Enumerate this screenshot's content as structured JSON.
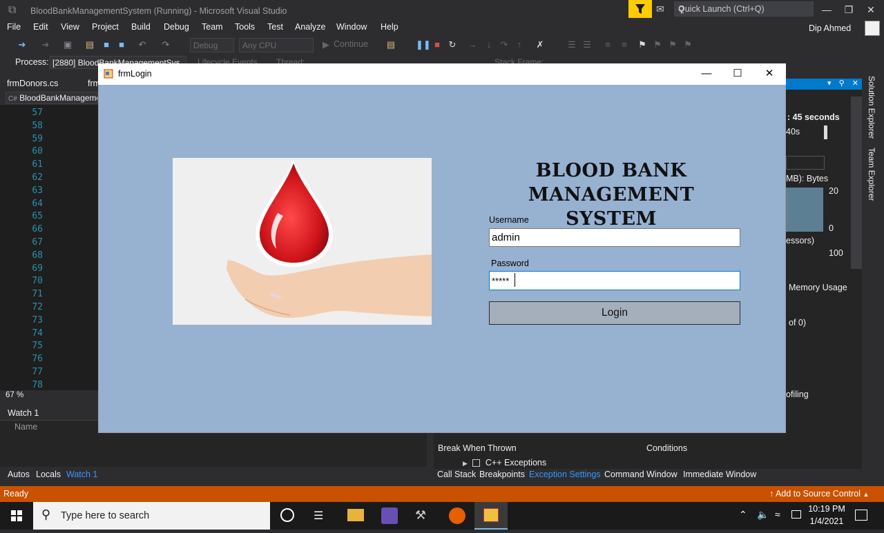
{
  "window": {
    "title": "BloodBankManagementSystem (Running) - Microsoft Visual Studio"
  },
  "quick_launch": {
    "placeholder": "Quick Launch (Ctrl+Q)"
  },
  "menu": [
    "File",
    "Edit",
    "View",
    "Project",
    "Build",
    "Debug",
    "Team",
    "Tools",
    "Test",
    "Analyze",
    "Window",
    "Help"
  ],
  "user": {
    "name": "Dip Ahmed"
  },
  "toolbar": {
    "config": "Debug",
    "platform": "Any CPU",
    "continue": "Continue",
    "process_label": "Process:",
    "process_value": "[2880] BloodBankManagementSys",
    "lifecycle": "Lifecycle Events",
    "thread": "Thread:",
    "stack_frame": "Stack Frame:"
  },
  "doc_tabs": [
    "frmDonors.cs",
    "frm"
  ],
  "nav_bar": "BloodBankManageme",
  "editor": {
    "line_numbers": [
      "57",
      "58",
      "59",
      "60",
      "61",
      "62",
      "63",
      "64",
      "65",
      "66",
      "67",
      "68",
      "69",
      "70",
      "71",
      "72",
      "73",
      "74",
      "75",
      "76",
      "77",
      "78"
    ],
    "zoom": "67 %"
  },
  "watch": {
    "title": "Watch 1",
    "name_col": "Name",
    "tabs": [
      "Autos",
      "Locals",
      "Watch 1"
    ]
  },
  "diagnostics": {
    "time": ": 45 seconds",
    "axis": "40s",
    "mem_label": "MB): Bytes",
    "mem_max": "20",
    "mem_min": "0",
    "cpu_label": "essors)",
    "cpu_max": "100",
    "tab": "Memory Usage",
    "count": "of 0)",
    "profiling": "ofiling"
  },
  "side_tabs": [
    "Solution Explorer",
    "Team Explorer"
  ],
  "exceptions": {
    "col1": "Break When Thrown",
    "col2": "Conditions",
    "row": "C++ Exceptions"
  },
  "debug_tabs": [
    "Call Stack",
    "Breakpoints",
    "Exception Settings",
    "Command Window",
    "Immediate Window"
  ],
  "status": {
    "ready": "Ready",
    "source_control": "Add to Source Control"
  },
  "taskbar": {
    "search_placeholder": "Type here to search",
    "time": "10:19 PM",
    "date": "1/4/2021"
  },
  "form": {
    "title": "frmLogin",
    "app_title_line1": "BLOOD BANK",
    "app_title_line2": "MANAGEMENT SYSTEM",
    "username_label": "Username",
    "username_value": "admin",
    "password_label": "Password",
    "password_value": "*****",
    "login_button": "Login"
  },
  "colors": {
    "accent": "#007acc",
    "status": "#ca5100",
    "form_bg": "#97b1d1",
    "drop": "#d0141a"
  }
}
